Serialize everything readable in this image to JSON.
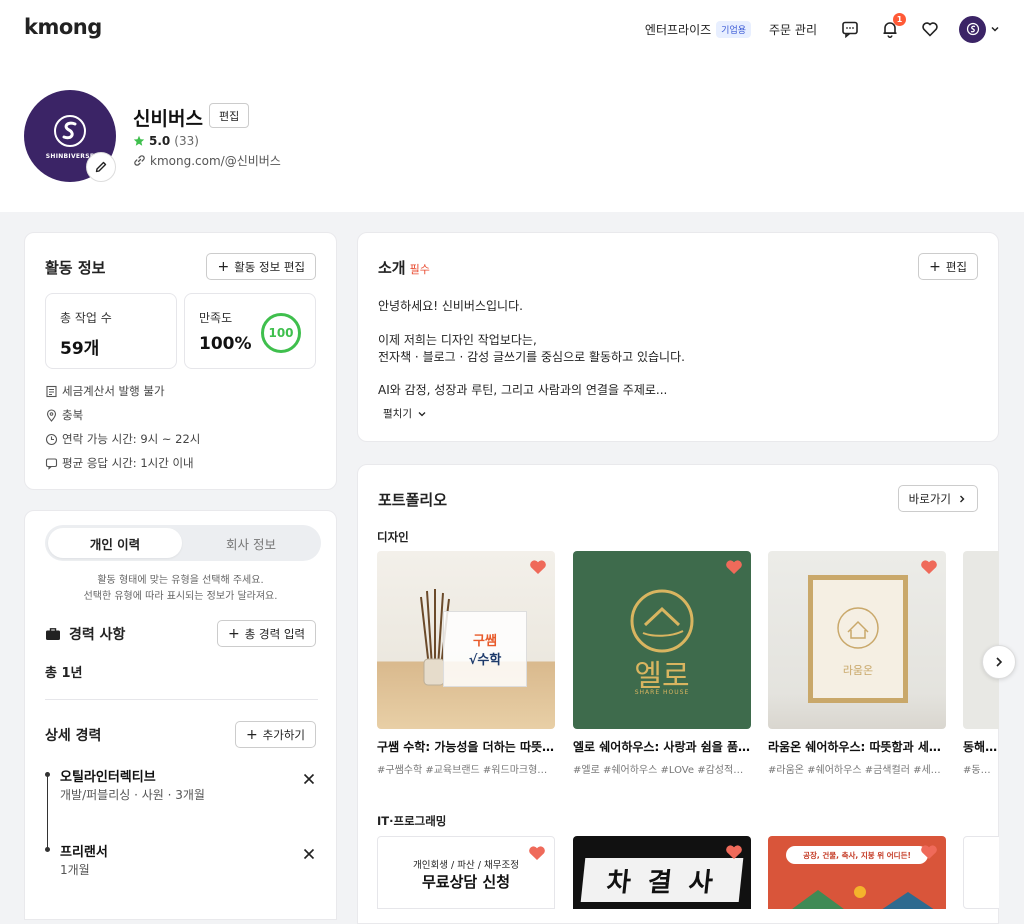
{
  "header": {
    "logo": "kmong",
    "enterprise": "엔터프라이즈",
    "enterprise_badge": "기업용",
    "orders": "주문 관리",
    "notification_count": "1"
  },
  "profile": {
    "name": "신비버스",
    "edit_label": "편집",
    "rating": "5.0",
    "review_count": "(33)",
    "link": "kmong.com/@신비버스",
    "brand_mark": "SHINBIVERSE"
  },
  "activity": {
    "title": "활동 정보",
    "edit_button": "활동 정보 편집",
    "total_jobs_label": "총 작업 수",
    "total_jobs_value": "59개",
    "satisfaction_label": "만족도",
    "satisfaction_value": "100%",
    "satisfaction_ring": "100",
    "info": [
      "세금계산서 발행 불가",
      "충북",
      "연락 가능 시간: 9시 ~ 22시",
      "평균 응답 시간: 1시간 이내"
    ]
  },
  "career": {
    "tab_personal": "개인 이력",
    "tab_company": "회사 정보",
    "hint_line1": "활동 형태에 맞는 유형을 선택해 주세요.",
    "hint_line2": "선택한 유형에 따라 표시되는 정보가 달라져요.",
    "exp_title": "경력 사항",
    "exp_button": "총 경력 입력",
    "exp_total": "총 1년",
    "detail_title": "상세 경력",
    "add_button": "추가하기",
    "items": [
      {
        "name": "오틸라인터렉티브",
        "sub": "개발/퍼블리싱 · 사원 · 3개월"
      },
      {
        "name": "프리랜서",
        "sub": "1개월"
      }
    ]
  },
  "intro": {
    "title": "소개",
    "required": "필수",
    "edit_button": "편집",
    "lines": [
      "안녕하세요! 신비버스입니다.",
      "이제 저희는 디자인 작업보다는,",
      "전자책 · 블로그 · 감성 글쓰기를 중심으로 활동하고 있습니다.",
      "AI와 감정, 성장과 루틴, 그리고 사람과의 연결을 주제로..."
    ],
    "expand": "펼치기"
  },
  "portfolio": {
    "title": "포트폴리오",
    "go_button": "바로가기",
    "cat_design": "디자인",
    "cat_it": "IT·프로그래밍",
    "design_items": [
      {
        "title": "구쌤 수학: 가능성을 더하는 따뜻한 수업",
        "tags": "#구쌤수학 #교육브랜드 #워드마크형로고 #...",
        "img_text_1": "구쌤",
        "img_text_2": "√수학"
      },
      {
        "title": "엘로 쉐어하우스: 사랑과 쉼을 품은 감...",
        "tags": "#엘로 #쉐어하우스 #LOVe #감성적인 #심...",
        "img_text_1": "엘로",
        "img_text_2": "SHARE HOUSE"
      },
      {
        "title": "라움온 쉐어하우스: 따뜻함과 세련미...",
        "tags": "#라움온 #쉐어하우스 #금색컬러 #세련된 #...",
        "img_text_1": "라움온",
        "img_text_2": ""
      },
      {
        "title": "동해소스...",
        "tags": "#동해소스...",
        "img_text_1": "",
        "img_text_2": ""
      }
    ],
    "it_items": [
      {
        "img_text_1": "개인회생 / 파산 / 채무조정",
        "img_text_2": "무료상담 신청"
      },
      {
        "img_text_1": "차 결 사",
        "img_text_2": ""
      },
      {
        "img_text_1": "공장, 건물, 축사, 지붕 위 어디든!",
        "img_text_2": ""
      },
      {
        "img_text_1": "",
        "img_text_2": ""
      }
    ]
  },
  "colors": {
    "brand_purple": "#3b2466",
    "green": "#3fbf4d",
    "heart": "#ef6a5a",
    "required_red": "#e84a2f"
  }
}
